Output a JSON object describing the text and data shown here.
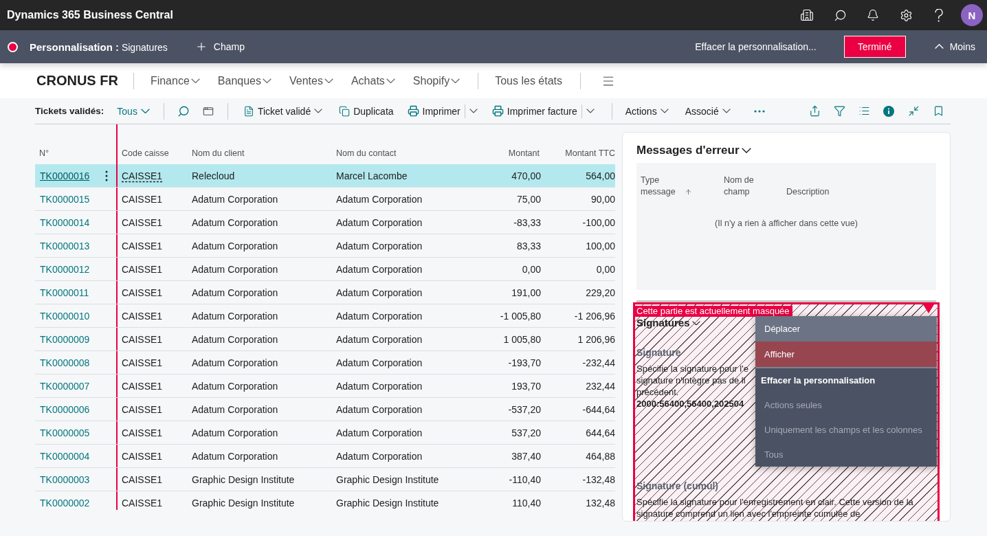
{
  "app_bar": {
    "title": "Dynamics 365 Business Central",
    "avatar": "N"
  },
  "personalization_bar": {
    "title": "**Personnalisation :** Signatures",
    "add_field": "Champ",
    "clear_link": "Effacer la personnalisation...",
    "done_button": "Terminé",
    "collapse_button": "Moins"
  },
  "navigation": {
    "company": "CRONUS FR",
    "menus": [
      "Finance",
      "Banques",
      "Ventes",
      "Achats",
      "Shopify"
    ],
    "all_reports": "Tous les états"
  },
  "action_bar": {
    "list_label": "Tickets validés:",
    "view": "Tous",
    "actions": [
      {
        "label": "Ticket validé",
        "kind": "dropdown"
      },
      {
        "label": "Duplicata",
        "kind": "button"
      },
      {
        "label": "Imprimer",
        "kind": "split"
      },
      {
        "label": "Imprimer facture",
        "kind": "split"
      },
      {
        "label": "Actions",
        "kind": "menu"
      },
      {
        "label": "Associé",
        "kind": "menu"
      }
    ]
  },
  "table": {
    "columns": [
      {
        "label": "N°",
        "kind": "link",
        "frozen": true
      },
      {
        "label": "Code caisse",
        "kind": "text",
        "frozen": false
      },
      {
        "label": "Nom du client",
        "kind": "text",
        "frozen": false
      },
      {
        "label": "Nom du contact",
        "kind": "text",
        "frozen": false
      },
      {
        "label": "Montant",
        "kind": "amount",
        "frozen": false
      },
      {
        "label": "Montant TTC",
        "kind": "amount",
        "frozen": false
      }
    ],
    "rows": [
      {
        "selected": true,
        "cells": [
          "TK0000016",
          "CAISSE1",
          "Relecloud",
          "Marcel Lacombe",
          "470,00",
          "564,00"
        ]
      },
      {
        "selected": false,
        "cells": [
          "TK0000015",
          "CAISSE1",
          "Adatum Corporation",
          "Adatum Corporation",
          "75,00",
          "90,00"
        ]
      },
      {
        "selected": false,
        "cells": [
          "TK0000014",
          "CAISSE1",
          "Adatum Corporation",
          "Adatum Corporation",
          "-83,33",
          "-100,00"
        ]
      },
      {
        "selected": false,
        "cells": [
          "TK0000013",
          "CAISSE1",
          "Adatum Corporation",
          "Adatum Corporation",
          "83,33",
          "100,00"
        ]
      },
      {
        "selected": false,
        "cells": [
          "TK0000012",
          "CAISSE1",
          "Adatum Corporation",
          "Adatum Corporation",
          "0,00",
          "0,00"
        ]
      },
      {
        "selected": false,
        "cells": [
          "TK0000011",
          "CAISSE1",
          "Adatum Corporation",
          "Adatum Corporation",
          "191,00",
          "229,20"
        ]
      },
      {
        "selected": false,
        "cells": [
          "TK0000010",
          "CAISSE1",
          "Adatum Corporation",
          "Adatum Corporation",
          "-1 005,80",
          "-1 206,96"
        ]
      },
      {
        "selected": false,
        "cells": [
          "TK0000009",
          "CAISSE1",
          "Adatum Corporation",
          "Adatum Corporation",
          "1 005,80",
          "1 206,96"
        ]
      },
      {
        "selected": false,
        "cells": [
          "TK0000008",
          "CAISSE1",
          "Adatum Corporation",
          "Adatum Corporation",
          "-193,70",
          "-232,44"
        ]
      },
      {
        "selected": false,
        "cells": [
          "TK0000007",
          "CAISSE1",
          "Adatum Corporation",
          "Adatum Corporation",
          "193,70",
          "232,44"
        ]
      },
      {
        "selected": false,
        "cells": [
          "TK0000006",
          "CAISSE1",
          "Adatum Corporation",
          "Adatum Corporation",
          "-537,20",
          "-644,64"
        ]
      },
      {
        "selected": false,
        "cells": [
          "TK0000005",
          "CAISSE1",
          "Adatum Corporation",
          "Adatum Corporation",
          "537,20",
          "644,64"
        ]
      },
      {
        "selected": false,
        "cells": [
          "TK0000004",
          "CAISSE1",
          "Adatum Corporation",
          "Adatum Corporation",
          "387,40",
          "464,88"
        ]
      },
      {
        "selected": false,
        "cells": [
          "TK0000003",
          "CAISSE1",
          "Graphic Design Institute",
          "Graphic Design Institute",
          "-110,40",
          "-132,48"
        ]
      },
      {
        "selected": false,
        "cells": [
          "TK0000002",
          "CAISSE1",
          "Graphic Design Institute",
          "Graphic Design Institute",
          "110,40",
          "132,48"
        ]
      }
    ]
  },
  "factbox": {
    "errors": {
      "title": "Messages d'erreur",
      "columns": [
        {
          "label": "Type message",
          "sorted": true
        },
        {
          "label": "Nom de champ",
          "sorted": false
        },
        {
          "label": "Description",
          "sorted": false
        }
      ],
      "empty_text": "(Il n'y a rien à afficher dans cette vue)"
    },
    "signatures": {
      "hidden": true,
      "hidden_badge": "Cette partie est actuellement masquée",
      "title": "Signatures",
      "fields": [
        {
          "label": "Signature",
          "description_lines": [
            "Spécifie la signature pour l'e",
            "signature n'intègre pas de li",
            "précédent."
          ],
          "value": "2000:56400,56400,202504"
        },
        {
          "label": "Signature (cumul)",
          "description_lines": [
            "Spécifie la signature pour l'enregistrement en clair. Cette version de la",
            "signature comprend un lien avec l'empreinte cumulée de"
          ]
        }
      ]
    }
  },
  "context_menu": {
    "items": [
      {
        "label": "Déplacer",
        "kind": "action",
        "selected": false
      },
      {
        "label": "Afficher",
        "kind": "action",
        "selected": true
      },
      {
        "label": "Effacer la personnalisation",
        "kind": "heading",
        "selected": false
      },
      {
        "label": "Actions seules",
        "kind": "option",
        "selected": false
      },
      {
        "label": "Uniquement les champs et les colonnes",
        "kind": "option",
        "selected": false
      },
      {
        "label": "Tous",
        "kind": "option",
        "selected": false
      }
    ]
  }
}
